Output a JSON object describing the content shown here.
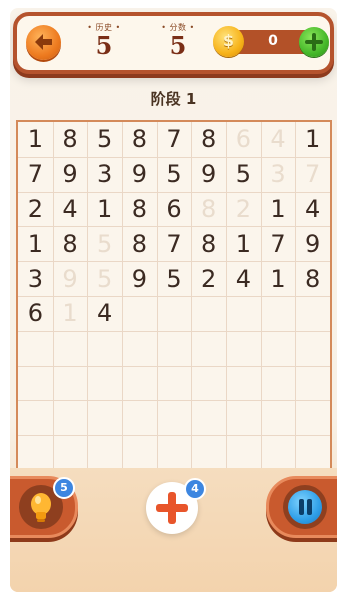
{
  "header": {
    "history_label": "• 历史 •",
    "history_value": "5",
    "score_label": "• 分数 •",
    "score_value": "5",
    "coin_symbol": "$",
    "coin_value": "0"
  },
  "stage_title": "阶段 1",
  "board": {
    "columns": 9,
    "rows": 10,
    "cells": [
      {
        "v": "1",
        "dim": false
      },
      {
        "v": "8",
        "dim": false
      },
      {
        "v": "5",
        "dim": false
      },
      {
        "v": "8",
        "dim": false
      },
      {
        "v": "7",
        "dim": false
      },
      {
        "v": "8",
        "dim": false
      },
      {
        "v": "6",
        "dim": true
      },
      {
        "v": "4",
        "dim": true
      },
      {
        "v": "1",
        "dim": false
      },
      {
        "v": "7",
        "dim": false
      },
      {
        "v": "9",
        "dim": false
      },
      {
        "v": "3",
        "dim": false
      },
      {
        "v": "9",
        "dim": false
      },
      {
        "v": "5",
        "dim": false
      },
      {
        "v": "9",
        "dim": false
      },
      {
        "v": "5",
        "dim": false
      },
      {
        "v": "3",
        "dim": true
      },
      {
        "v": "7",
        "dim": true
      },
      {
        "v": "2",
        "dim": false
      },
      {
        "v": "4",
        "dim": false
      },
      {
        "v": "1",
        "dim": false
      },
      {
        "v": "8",
        "dim": false
      },
      {
        "v": "6",
        "dim": false
      },
      {
        "v": "8",
        "dim": true
      },
      {
        "v": "2",
        "dim": true
      },
      {
        "v": "1",
        "dim": false
      },
      {
        "v": "4",
        "dim": false
      },
      {
        "v": "1",
        "dim": false
      },
      {
        "v": "8",
        "dim": false
      },
      {
        "v": "5",
        "dim": true
      },
      {
        "v": "8",
        "dim": false
      },
      {
        "v": "7",
        "dim": false
      },
      {
        "v": "8",
        "dim": false
      },
      {
        "v": "1",
        "dim": false
      },
      {
        "v": "7",
        "dim": false
      },
      {
        "v": "9",
        "dim": false
      },
      {
        "v": "3",
        "dim": false
      },
      {
        "v": "9",
        "dim": true
      },
      {
        "v": "5",
        "dim": true
      },
      {
        "v": "9",
        "dim": false
      },
      {
        "v": "5",
        "dim": false
      },
      {
        "v": "2",
        "dim": false
      },
      {
        "v": "4",
        "dim": false
      },
      {
        "v": "1",
        "dim": false
      },
      {
        "v": "8",
        "dim": false
      },
      {
        "v": "6",
        "dim": false
      },
      {
        "v": "1",
        "dim": true
      },
      {
        "v": "4",
        "dim": false
      }
    ]
  },
  "buttons": {
    "hint_badge": "5",
    "add_badge": "4"
  },
  "colors": {
    "accent": "#c95a2e",
    "number": "#3b2a22",
    "number_cleared": "#e9dccd"
  }
}
